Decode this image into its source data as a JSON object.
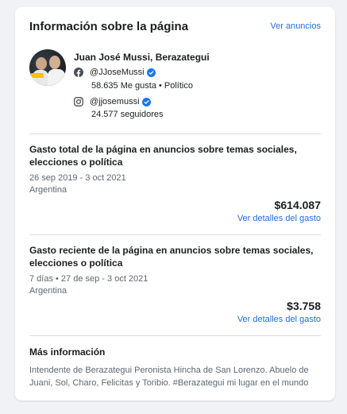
{
  "header": {
    "title": "Información sobre la página",
    "ads_link": "Ver anuncios"
  },
  "profile": {
    "name": "Juan José Mussi, Berazategui",
    "facebook": {
      "handle": "@JJoseMussi",
      "stats": "58.635 Me gusta • Político",
      "icon": "facebook-icon"
    },
    "instagram": {
      "handle": "@jjosemussi",
      "stats": "24.577 seguidores",
      "icon": "instagram-icon"
    }
  },
  "total_spend": {
    "title": "Gasto total de la página en anuncios sobre temas sociales, elecciones o política",
    "date_range": "26 sep 2019 - 3 oct 2021",
    "country": "Argentina",
    "amount": "$614.087",
    "link": "Ver detalles del gasto"
  },
  "recent_spend": {
    "title": "Gasto reciente de la página en anuncios sobre temas sociales, elecciones o política",
    "date_range": "7 días • 27 de sep - 3 oct 2021",
    "country": "Argentina",
    "amount": "$3.758",
    "link": "Ver detalles del gasto"
  },
  "more_info": {
    "title": "Más información",
    "bio": "Intendente de Berazategui Peronista Hincha de San Lorenzo. Abuelo de Juani, Sol, Charo, Felicitas y Toribio. #Berazategui mi lugar en el mundo"
  },
  "colors": {
    "link": "#216fdb",
    "verified": "#1877f2",
    "divider": "#dadde1"
  }
}
